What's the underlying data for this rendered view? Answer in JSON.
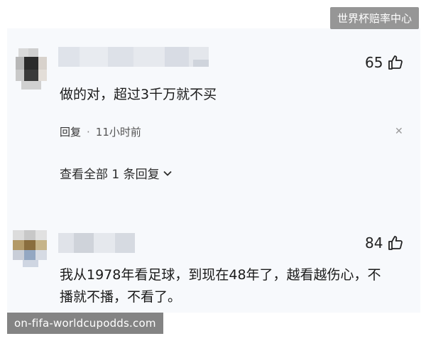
{
  "watermark_top": "世界杯赔率中心",
  "watermark_bottom": "on-fifa-worldcupodds.com",
  "comments": [
    {
      "likes": "65",
      "text": "做的对，超过3千万就不买",
      "reply_label": "回复",
      "time": "11小时前",
      "view_replies": "查看全部 1 条回复"
    },
    {
      "likes": "84",
      "text_line1": "我从1978年看足球，到现在48年了，越看越伤心，不",
      "text_line2": "播就不播，不看了。"
    }
  ]
}
